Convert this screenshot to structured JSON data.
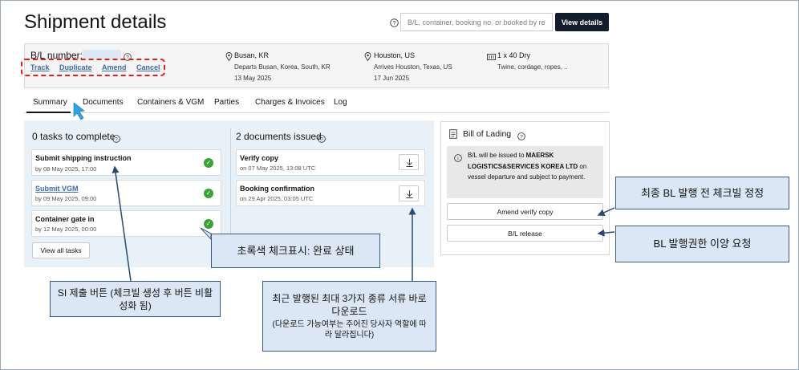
{
  "header": {
    "title": "Shipment details",
    "search_placeholder": "B/L, container, booking no. or booked by ref.",
    "view_button": "View details"
  },
  "bl": {
    "label": "B/L number:",
    "actions": [
      "Track",
      "Duplicate",
      "Amend",
      "Cancel"
    ],
    "origin": {
      "city": "Busan, KR",
      "detail": "Departs Busan, Korea, South, KR",
      "date": "13 May 2025"
    },
    "destination": {
      "city": "Houston, US",
      "detail": "Arrives Houston, Texas, US",
      "date": "17 Jun 2025"
    },
    "container": {
      "size": "1 x 40 Dry",
      "cargo": "Twine, cordage, ropes, .."
    }
  },
  "tabs": [
    "Summary",
    "Documents",
    "Containers & VGM",
    "Parties",
    "Charges & Invoices",
    "Log"
  ],
  "tasks": {
    "heading": "0 tasks to complete",
    "items": [
      {
        "title": "Submit shipping instruction",
        "sub": "by 08 May 2025, 17:00"
      },
      {
        "title": "Submit VGM",
        "sub": "by 09 May 2025, 09:00"
      },
      {
        "title": "Container gate in",
        "sub": "by 12 May 2025, 00:00"
      }
    ],
    "view_all": "View all tasks"
  },
  "documents": {
    "heading": "2 documents issued",
    "items": [
      {
        "title": "Verify copy",
        "sub": "on 07 May 2025, 13:08 UTC"
      },
      {
        "title": "Booking confirmation",
        "sub": "on 29 Apr 2025, 03:05 UTC"
      }
    ]
  },
  "bol": {
    "title": "Bill of Lading",
    "note_prefix": "B/L will be issued to ",
    "note_bold": "MAERSK LOGISTICS&SERVICES KOREA LTD",
    "note_suffix": " on vessel departure and subject to payment.",
    "amend_button": "Amend verify copy",
    "release_button": "B/L release"
  },
  "callouts": {
    "amend": "최종 BL 발행 전 체크빌 정정",
    "release": "BL 발행권한 이양 요청",
    "checkmark": "초록색 체크표시: 완료 상태",
    "si": "SI 제출 버튼 (체크빌 생성 후 버튼 비활성화 됨)",
    "docs_main": "최근 발행된 최대 3가지 종류 서류 바로 다운로드",
    "docs_note": "(다운로드 가능여부는 주어진 당사자 역할에 따라 달라집니다)"
  },
  "colors": {
    "accent": "#141d2e",
    "link": "#3f6ba8",
    "success": "#3aa335",
    "annotation": "#e02020",
    "callout_bg": "#dbe7f5",
    "arrow": "#2a4a70"
  }
}
